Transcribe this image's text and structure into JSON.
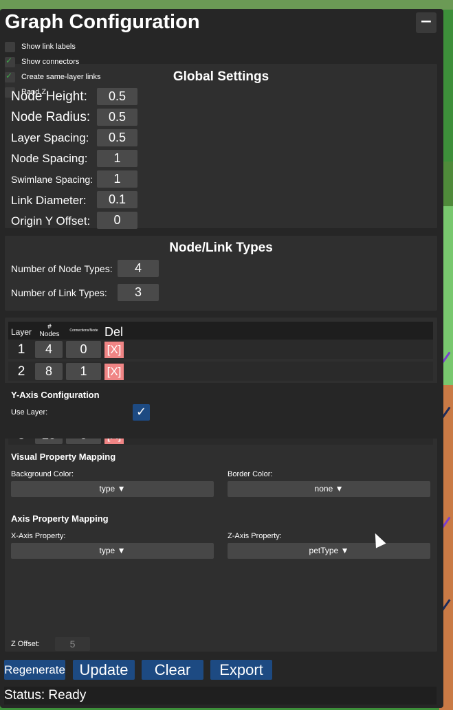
{
  "title": "Graph Configuration",
  "minimize_label": "−",
  "checkboxes": [
    {
      "label": "Show link labels",
      "checked": false
    },
    {
      "label": "Show connectors",
      "checked": true
    },
    {
      "label": "Create same-layer links",
      "checked": true
    },
    {
      "label": "Rand Z",
      "checked": false
    }
  ],
  "global_settings": {
    "title": "Global Settings",
    "fields": [
      {
        "label": "Node Height:",
        "value": "0.5"
      },
      {
        "label": "Node Radius:",
        "value": "0.5"
      },
      {
        "label": "Layer Spacing:",
        "value": "0.5"
      },
      {
        "label": "Node Spacing:",
        "value": "1"
      },
      {
        "label": "Swimlane Spacing:",
        "value": "1"
      },
      {
        "label": "Link Diameter:",
        "value": "0.1"
      },
      {
        "label": "Origin Y Offset:",
        "value": "0"
      }
    ]
  },
  "node_link_types": {
    "title": "Node/Link Types",
    "fields": [
      {
        "label": "Number of Node Types:",
        "value": "4"
      },
      {
        "label": "Number of Link Types:",
        "value": "3"
      }
    ]
  },
  "layers": {
    "headers": {
      "layer": "Layer",
      "nodes": "# Nodes",
      "connections": "Connections/Node",
      "del": "Del"
    },
    "rows": [
      {
        "layer": "1",
        "nodes": "4",
        "connections": "0",
        "del": "[X]"
      },
      {
        "layer": "2",
        "nodes": "8",
        "connections": "1",
        "del": "[X]"
      },
      {
        "layer": "3",
        "nodes": "20",
        "connections": "0",
        "del": "[X]"
      }
    ]
  },
  "y_axis": {
    "title": "Y-Axis Configuration",
    "use_layer_label": "Use Layer:",
    "use_layer_mark": "✓"
  },
  "visual_mapping": {
    "title": "Visual Property Mapping",
    "background_label": "Background Color:",
    "background_value": "type ▼",
    "border_label": "Border Color:",
    "border_value": "none ▼"
  },
  "axis_mapping": {
    "title": "Axis Property Mapping",
    "x_label": "X-Axis Property:",
    "x_value": "type ▼",
    "z_label": "Z-Axis Property:",
    "z_value": "petType ▼"
  },
  "z_offset": {
    "label": "Z Offset:",
    "value": "5"
  },
  "buttons": {
    "regenerate": "Regenerate",
    "update": "Update",
    "clear": "Clear",
    "export": "Export"
  },
  "status": "Status: Ready",
  "colors": {
    "panel": "#262626",
    "section": "#2f2f2f",
    "button": "#1d4a82",
    "delete": "#f08585",
    "check": "#1d4a82"
  }
}
